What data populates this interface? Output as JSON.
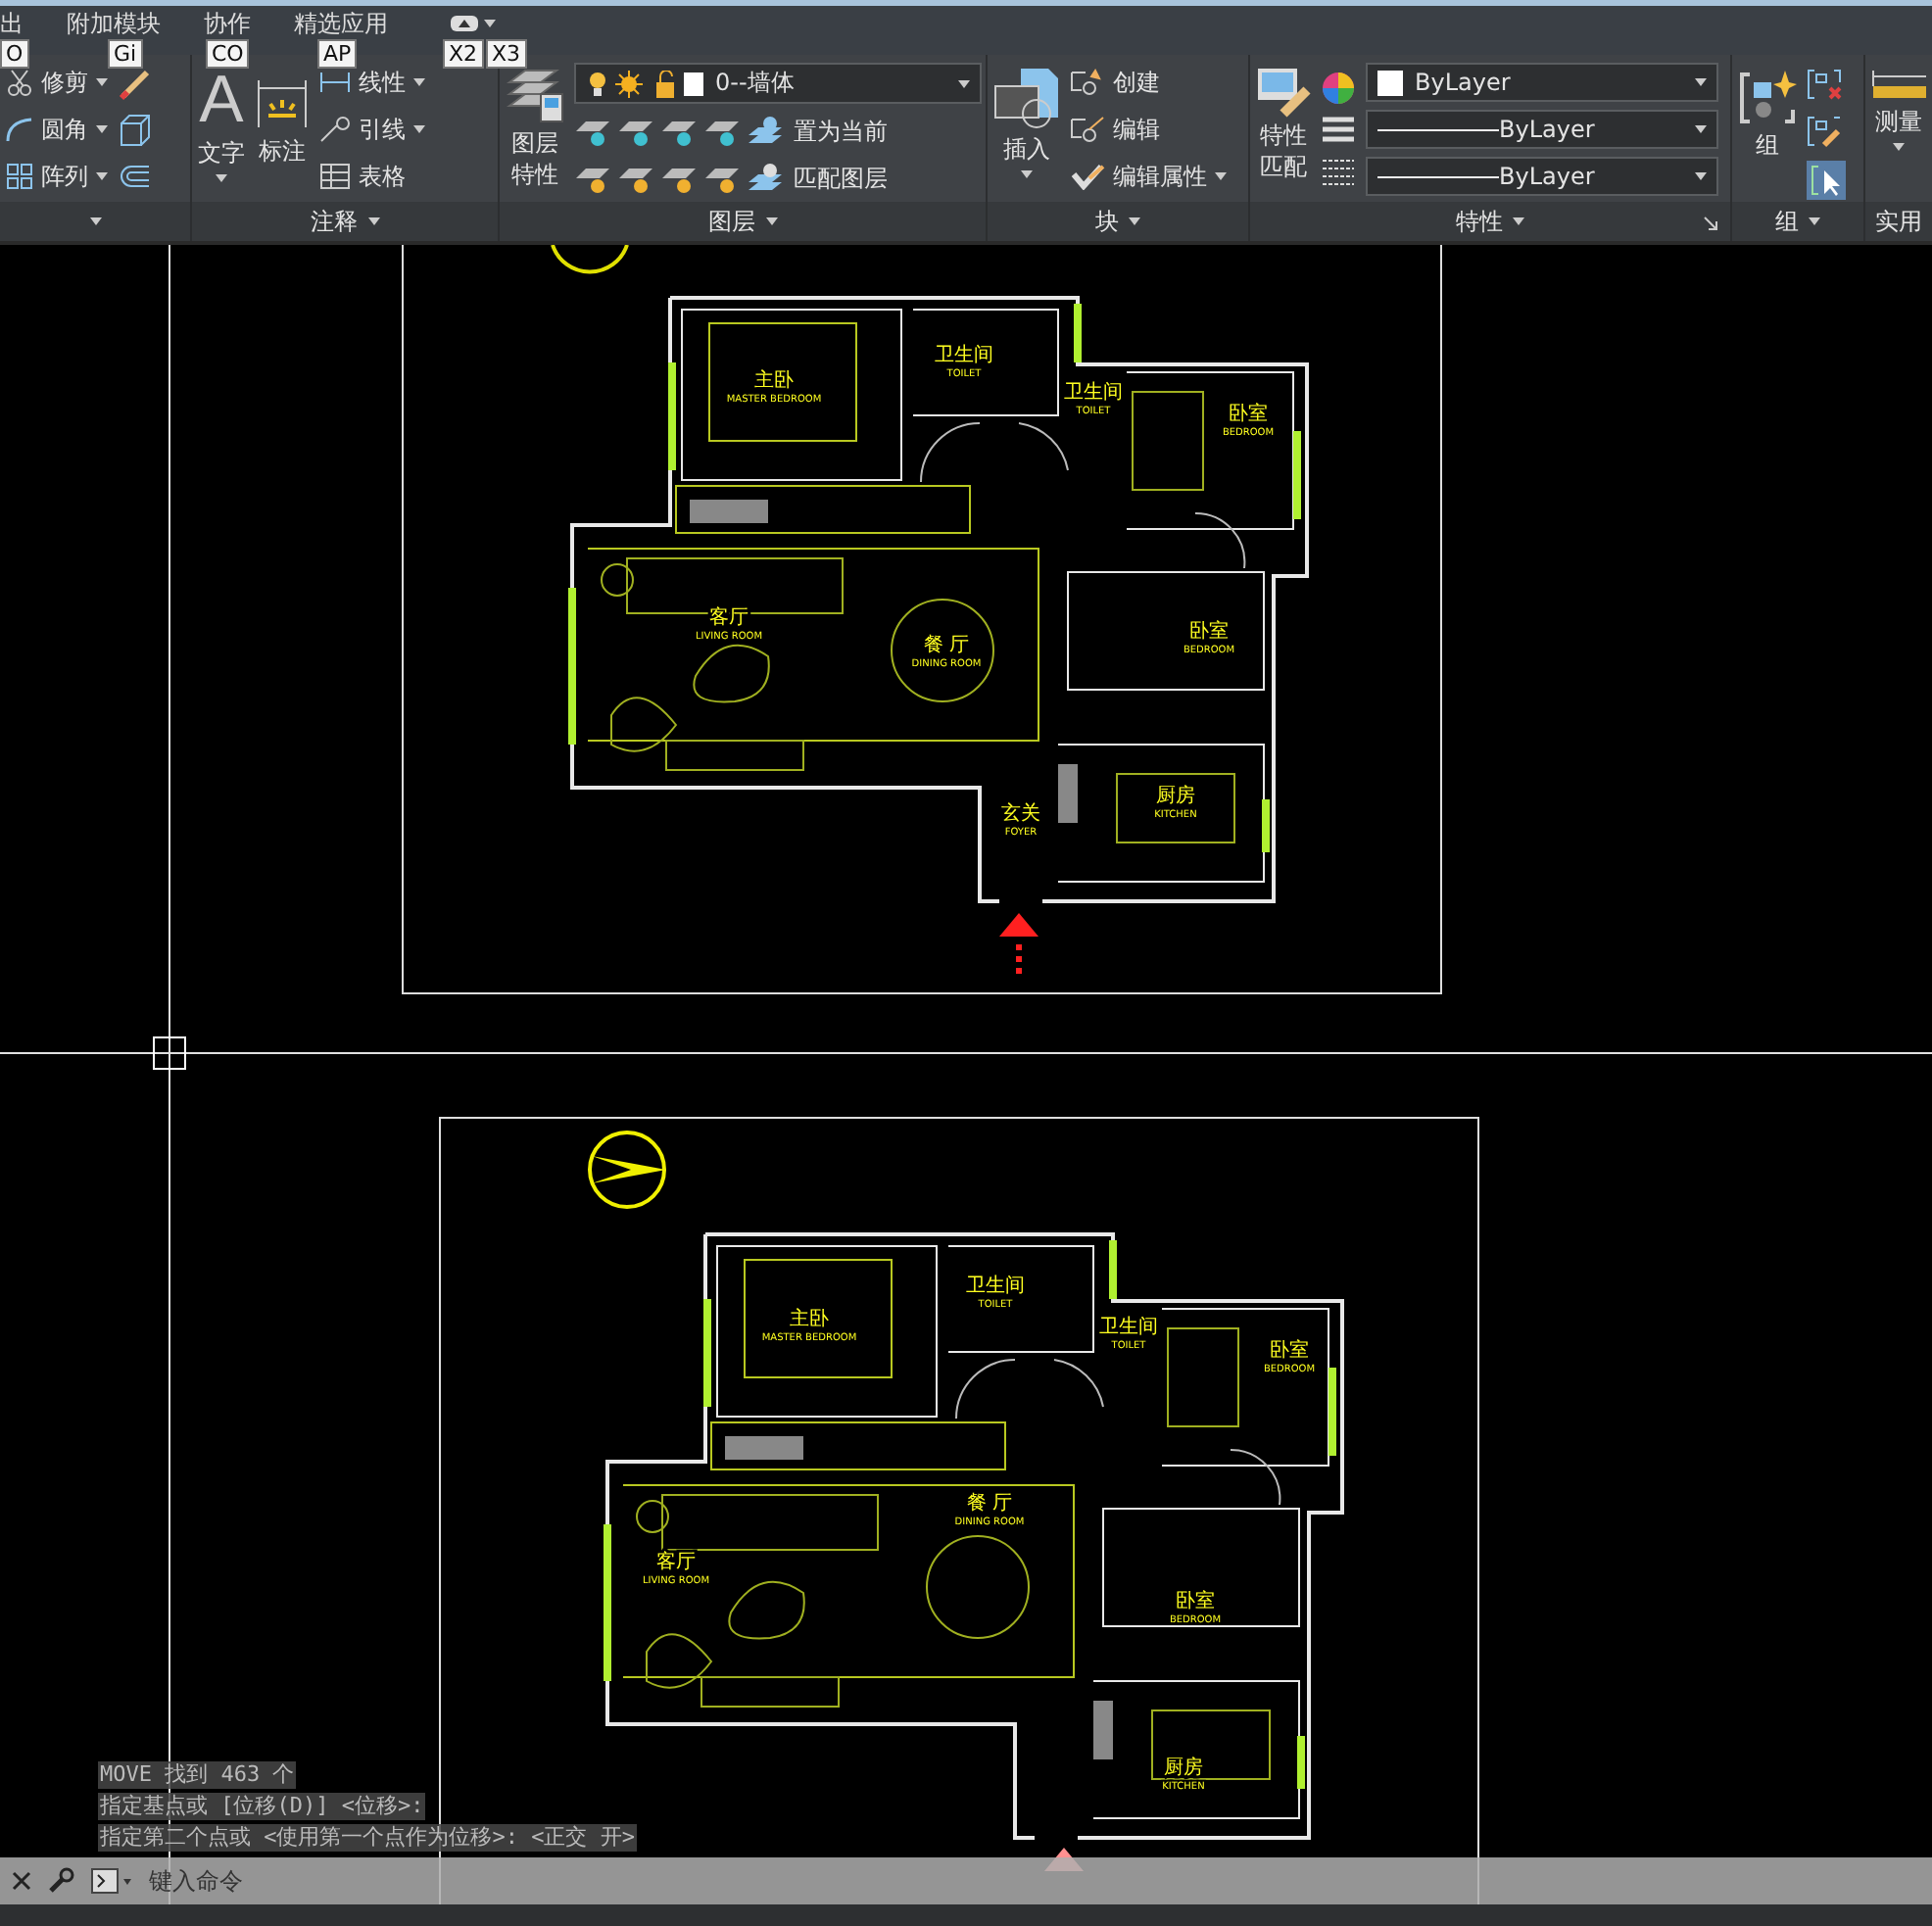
{
  "tabs": [
    "出",
    "附加模块",
    "协作",
    "精选应用"
  ],
  "key_tips": [
    "O",
    "Gi",
    "CO",
    "AP",
    "X2",
    "X3"
  ],
  "modify_panel": {
    "tools": [
      "修剪",
      "圆角",
      "阵列"
    ]
  },
  "annotation_panel": {
    "title": "注释",
    "text_icon": "A",
    "large_tools": [
      "文字",
      "标注"
    ],
    "tools": [
      "线性",
      "引线",
      "表格"
    ]
  },
  "layers_panel": {
    "title": "图层",
    "large_tool": "图层特性",
    "layer_dropdown": "0--墙体",
    "tools": [
      "置为当前",
      "匹配图层"
    ]
  },
  "block_panel": {
    "title": "块",
    "large_tool": "插入",
    "tools": [
      "创建",
      "编辑",
      "编辑属性"
    ]
  },
  "properties_panel": {
    "title": "特性",
    "large_tool": "特性匹配",
    "dropdowns": [
      "ByLayer",
      "ByLayer",
      "ByLayer"
    ]
  },
  "group_panel": {
    "title": "组",
    "large_tool": "组"
  },
  "utilities_panel": {
    "title": "实用",
    "large_tool": "测量"
  },
  "plans": [
    {
      "rooms": [
        {
          "zh": "主卧",
          "en": "MASTER BEDROOM"
        },
        {
          "zh": "卫生间",
          "en": "TOILET"
        },
        {
          "zh": "卫生间",
          "en": "TOILET"
        },
        {
          "zh": "卧室",
          "en": "BEDROOM"
        },
        {
          "zh": "客厅",
          "en": "LIVING ROOM"
        },
        {
          "zh": "餐 厅",
          "en": "DINING ROOM"
        },
        {
          "zh": "卧室",
          "en": "BEDROOM"
        },
        {
          "zh": "厨房",
          "en": "KITCHEN"
        },
        {
          "zh": "玄关",
          "en": "FOYER"
        }
      ]
    },
    {
      "rooms": [
        {
          "zh": "主卧",
          "en": "MASTER BEDROOM"
        },
        {
          "zh": "卫生间",
          "en": "TOILET"
        },
        {
          "zh": "卫生间",
          "en": "TOILET"
        },
        {
          "zh": "卧室",
          "en": "BEDROOM"
        },
        {
          "zh": "客厅",
          "en": "LIVING ROOM"
        },
        {
          "zh": "餐 厅",
          "en": "DINING ROOM"
        },
        {
          "zh": "卧室",
          "en": "BEDROOM"
        },
        {
          "zh": "厨房",
          "en": "KITCHEN"
        }
      ]
    }
  ],
  "command_history": [
    "MOVE 找到 463 个",
    "指定基点或 [位移(D)] <位移>:",
    "指定第二个点或 <使用第一个点作为位移>: <正交 开>"
  ],
  "command_line": {
    "placeholder": "键入命令"
  }
}
